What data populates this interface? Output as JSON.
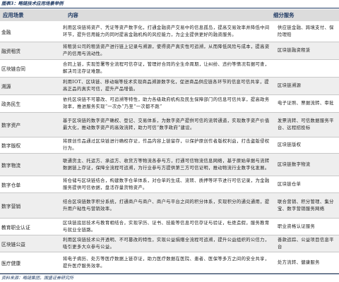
{
  "caption": "图表3：略链技术应用场景举例",
  "header": {
    "scene": "应用场景",
    "content": "内容",
    "service": "细分服务"
  },
  "rows": [
    {
      "scene": "金融",
      "content": "利用区块链将资产、凭证等资产数字化，打通金融资产交易中的信息孤岛，提高交易效率并降低中间环节，提升信用能力的同时提高金融机构的风控能力，为企业提供更好的融资服务。",
      "service": "供应链金融、跨境支付、保险理赔"
    },
    {
      "scene": "融资租赁",
      "content": "将租赁公司的租赁资产进行链上记录与溯源，使得资产真实性可追溯，从而降低风险与成本，提高资产的信用与流动性。",
      "service": "区块链融资租赁"
    },
    {
      "scene": "区块链合同",
      "content": "合同上链，实现签署等全流程可信存证，管理好合同的全生命周期，让纠纷、违约等情况有据可查，解决司法存证难题。",
      "service": ""
    },
    {
      "scene": "溯源",
      "content": "利用IOT、区块链、移动端等技术实现商品溯源数字化，促进商品供应链各环节的信息可信共享，提高正品的真实可信，提升产品增值。",
      "service": "区块链溯源"
    },
    {
      "scene": "政务民生",
      "content": "依托区块链不可篡改、可追溯等特性，助力各级政府机构及民生保障部门的信息可信共享，提高政务效率，推进服务实现“一次办”乃至“一次都不跑”",
      "service": "电子证照、票据流转、审批"
    },
    {
      "scene": "数字资产",
      "content": "基于区块链的数字资产确权、登记、交易体系，为数字资产提供可信的流转通道，实现数字资产价值最大化，推动数字资产的高效流转，助力可信“数字政府”建设。",
      "service": "发票流转、可信数据服务平台、远程招投标"
    },
    {
      "scene": "数字版权",
      "content": "将原创作品通过区块链进行确权存证，作品内容上链留存，以保护原创作者版权利益，打击盗版侵权行为。",
      "service": "区块链版权"
    },
    {
      "scene": "数字物流",
      "content": "联通货主、托运方、承运方、收货方等物流各参与方，打通可信物流信息网络，基于原始单据与流转数据链上存证，保障全流程可追溯，为行业参与方提供第三方可信证明，推动物流行业数字化发展。",
      "service": "区块链数字物流"
    },
    {
      "scene": "数字仓单",
      "content": "将仓储与区块链结合，构建数字仓单体系，对仓单的生成、流转、质押等环节进行可信记录，为金融服务提供可信依据，盘活存量货物资产。",
      "service": "区块链仓单"
    },
    {
      "scene": "数字营销",
      "content": "结合区块链数字积分系统，打通商户与商户、商户与平台之间的积分体系，实现积分的通兑通用，提升用户粘性与营销效率。",
      "service": "联合营销、积分管理、集分宝、数字营销服务网络"
    },
    {
      "scene": "教育职业认证",
      "content": "区块链底层技术与教育相结合，实现学历、证书、技能等信息可信存证与验证，杜绝造假，服务教育与就业全链路。",
      "service": "职业资格认证服务"
    },
    {
      "scene": "区块链公益",
      "content": "利用区块链技术公开透明、不可篡改的特性，实现公益捐赠全流程可追溯，提升公益组织的公信力，吸引更多大众参与公益。",
      "service": "善款追踪、公益项目信息平台"
    },
    {
      "scene": "医疗健康",
      "content": "将电子病历、处方等医疗数据上链存证，助力医疗数据在医院、患者、医保等多方之间的安全共享，提升医疗服务效率。",
      "service": "处方流转、健康服务"
    }
  ],
  "source": "资料来源：略链集团，国盛证券研究所"
}
